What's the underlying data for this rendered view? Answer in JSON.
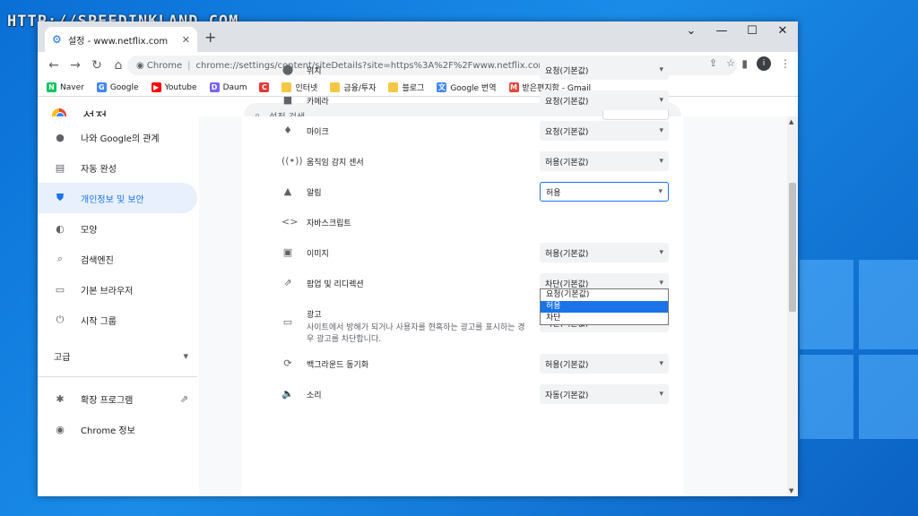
{
  "watermark": "HTTP://SPEEDINKLAND.COM",
  "tab": {
    "title": "설정 - www.netflix.com",
    "close": "✕",
    "new_tab": "+"
  },
  "window_controls": {
    "collapse": "⌄",
    "minimize": "—",
    "maximize": "☐",
    "close": "✕"
  },
  "toolbar": {
    "back": "←",
    "forward": "→",
    "reload": "↻",
    "home": "⌂",
    "chip": "Chrome",
    "url": "chrome://settings/content/siteDetails?site=https%3A%2F%2Fwww.netflix.com%3A443"
  },
  "bookmarks": [
    {
      "label": "Naver",
      "icon": "N",
      "color": "#03c75a"
    },
    {
      "label": "Google",
      "icon": "G",
      "color": "#4285f4"
    },
    {
      "label": "Youtube",
      "icon": "▶",
      "color": "#ff0000"
    },
    {
      "label": "Daum",
      "icon": "D",
      "color": "#7b61ff"
    },
    {
      "label": "",
      "icon": "C",
      "color": "#e53935"
    },
    {
      "label": "인터넷",
      "icon": "",
      "color": "#f6c744"
    },
    {
      "label": "금융/투자",
      "icon": "",
      "color": "#f6c744"
    },
    {
      "label": "블로그",
      "icon": "",
      "color": "#f6c744"
    },
    {
      "label": "Google 번역",
      "icon": "文",
      "color": "#4285f4"
    },
    {
      "label": "받은편지함 - Gmail",
      "icon": "M",
      "color": "#ea4335"
    }
  ],
  "header": {
    "title": "설정",
    "search_placeholder": "설정 검색"
  },
  "sidebar": {
    "items": [
      {
        "label": "나와 Google의 관계",
        "icon": "person-icon",
        "glyph": "●"
      },
      {
        "label": "자동 완성",
        "icon": "clipboard-icon",
        "glyph": "▤"
      },
      {
        "label": "개인정보 및 보안",
        "icon": "shield-icon",
        "glyph": "⛊"
      },
      {
        "label": "모양",
        "icon": "palette-icon",
        "glyph": "◐"
      },
      {
        "label": "검색엔진",
        "icon": "search-icon",
        "glyph": "⌕"
      },
      {
        "label": "기본 브라우저",
        "icon": "browser-icon",
        "glyph": "▭"
      },
      {
        "label": "시작 그룹",
        "icon": "power-icon",
        "glyph": "⏻"
      }
    ],
    "advanced": {
      "label": "고급",
      "arrow": "▾"
    },
    "extensions": {
      "label": "확장 프로그램",
      "glyph": "✱",
      "ext": "⇗"
    },
    "about": {
      "label": "Chrome 정보",
      "glyph": "◉"
    }
  },
  "permissions": [
    {
      "label": "위치",
      "icon": "location-icon",
      "glyph": "⬤",
      "value": "요청(기본값)"
    },
    {
      "label": "카메라",
      "icon": "camera-icon",
      "glyph": "■",
      "value": "요청(기본값)"
    },
    {
      "label": "마이크",
      "icon": "mic-icon",
      "glyph": "♦",
      "value": "요청(기본값)"
    },
    {
      "label": "움직임 감지 센서",
      "icon": "sensor-icon",
      "glyph": "((•))",
      "value": "허용(기본값)"
    },
    {
      "label": "알림",
      "icon": "bell-icon",
      "glyph": "▲",
      "value": "허용"
    },
    {
      "label": "자바스크립트",
      "icon": "code-icon",
      "glyph": "<>",
      "value": ""
    },
    {
      "label": "이미지",
      "icon": "image-icon",
      "glyph": "▣",
      "value": "허용(기본값)"
    },
    {
      "label": "팝업 및 리디렉션",
      "icon": "popup-icon",
      "glyph": "⇗",
      "value": "차단(기본값)"
    },
    {
      "label": "광고",
      "sub": "사이트에서 방해가 되거나 사용자를 현혹하는 광고를 표시하는 경우 광고를 차단합니다.",
      "icon": "ads-icon",
      "glyph": "▭",
      "value": "차단(기본값)"
    },
    {
      "label": "백그라운드 동기화",
      "icon": "sync-icon",
      "glyph": "⟳",
      "value": "허용(기본값)"
    },
    {
      "label": "소리",
      "icon": "sound-icon",
      "glyph": "🔈",
      "value": "자동(기본값)"
    }
  ],
  "dropdown": {
    "options": [
      "요청(기본값)",
      "허용",
      "차단"
    ],
    "selected": 1
  }
}
